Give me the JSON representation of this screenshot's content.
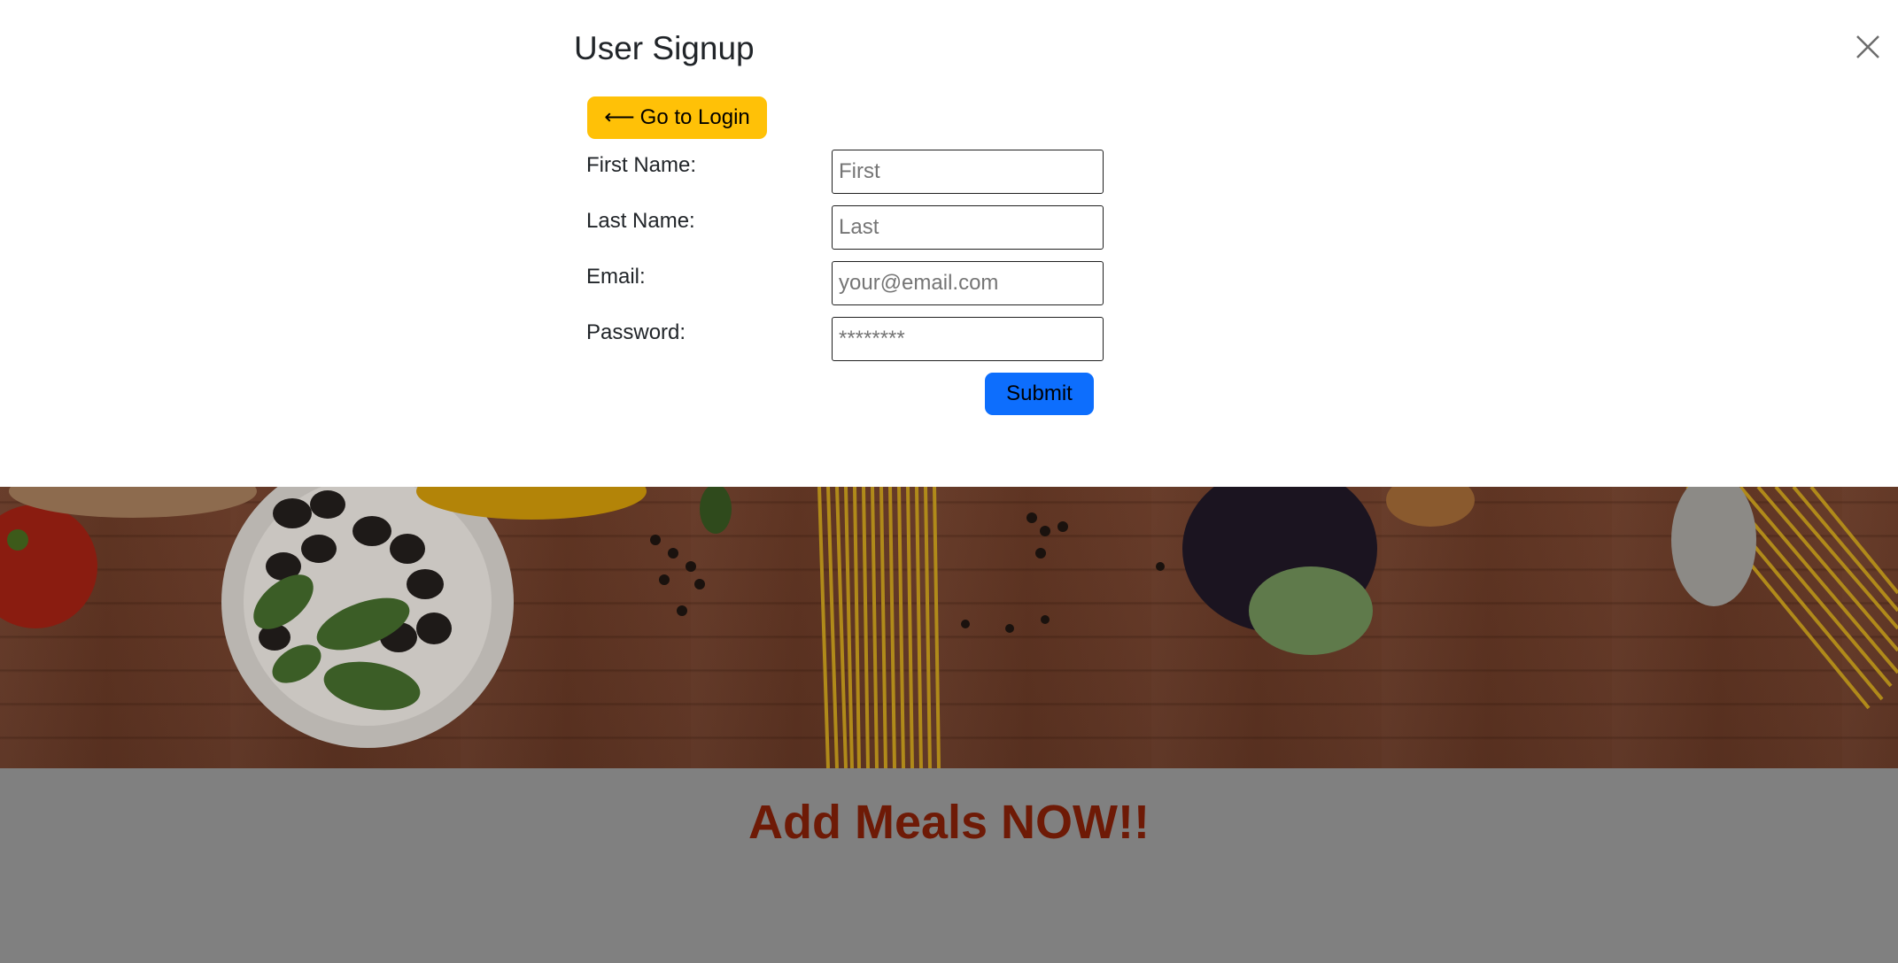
{
  "modal": {
    "title": "User Signup",
    "go_to_login_label": "Go to Login",
    "arrow_glyph": "⟵",
    "close_icon": "close-icon",
    "fields": [
      {
        "label": "First Name:",
        "placeholder": "First",
        "value": ""
      },
      {
        "label": "Last Name:",
        "placeholder": "Last",
        "value": ""
      },
      {
        "label": "Email:",
        "placeholder": "your@email.com",
        "value": ""
      },
      {
        "label": "Password:",
        "placeholder": "********",
        "value": ""
      }
    ],
    "submit_label": "Submit"
  },
  "page": {
    "headline": "Add Meals NOW!!"
  },
  "colors": {
    "login_button": "#ffc107",
    "submit_button": "#0d6efd",
    "headline": "#6e1a06",
    "overlay": "#808080"
  }
}
